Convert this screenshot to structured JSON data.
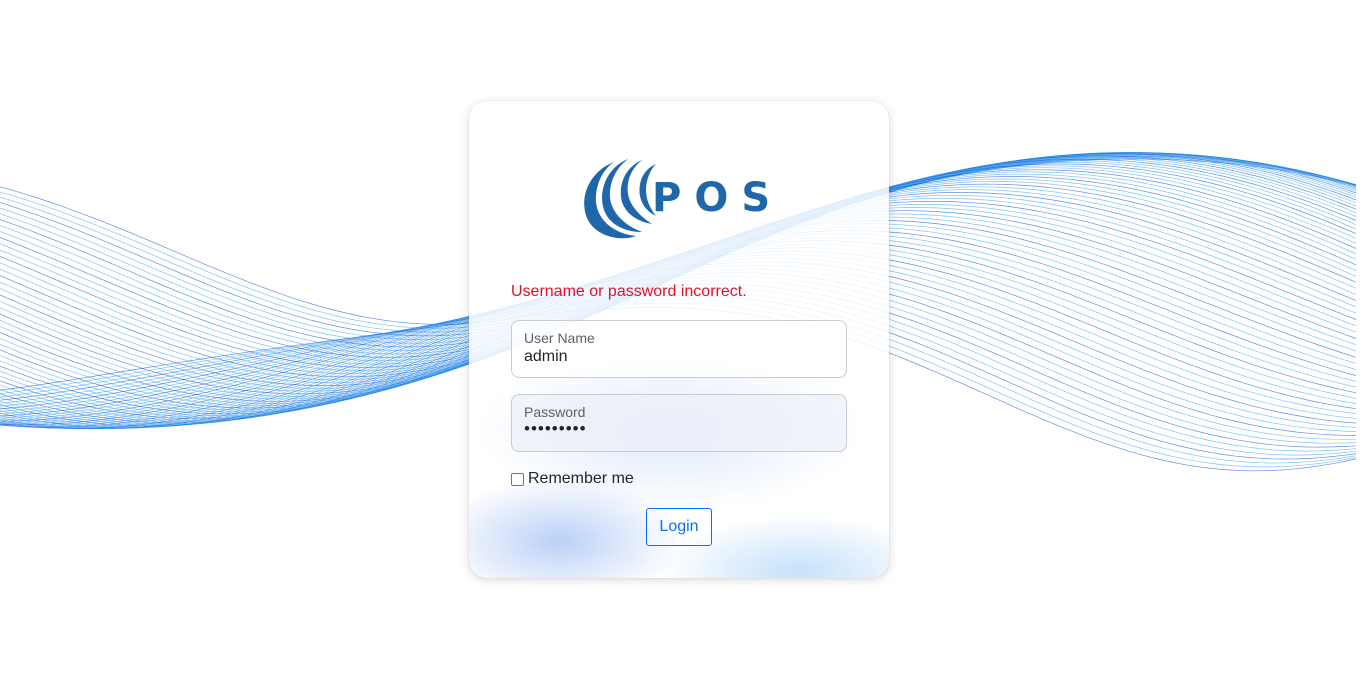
{
  "colors": {
    "brand": "#1f67aa",
    "error": "#e0102a",
    "button": "#0d6efd",
    "wave_dark": "#1a4fd8",
    "wave_light": "#38a8f0"
  },
  "logo": {
    "icon": "swoosh-logo-icon",
    "text": "POS"
  },
  "login": {
    "error_message": "Username or password incorrect.",
    "username": {
      "label": "User Name",
      "value": "admin"
    },
    "password": {
      "label": "Password",
      "value": "•••••••••"
    },
    "remember_label": "Remember me",
    "button_label": "Login"
  }
}
